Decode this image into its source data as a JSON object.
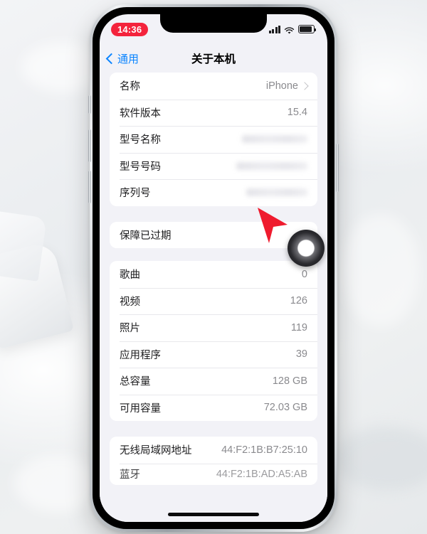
{
  "status_bar": {
    "time": "14:36",
    "recording_pill_color": "#f4233c",
    "icons": [
      "cellular-signal-icon",
      "wifi-icon",
      "battery-icon"
    ]
  },
  "nav": {
    "back_label": "通用",
    "title": "关于本机",
    "accent_color": "#0a84ff"
  },
  "groups": [
    {
      "rows": [
        {
          "label": "名称",
          "value": "iPhone",
          "chevron": true
        },
        {
          "label": "软件版本",
          "value": "15.4",
          "chevron": false
        },
        {
          "label": "型号名称",
          "value": "",
          "redacted": true
        },
        {
          "label": "型号号码",
          "value": "",
          "redacted": true
        },
        {
          "label": "序列号",
          "value": "",
          "redacted": true
        }
      ]
    },
    {
      "rows": [
        {
          "label": "保障已过期",
          "value": "",
          "chevron": false
        }
      ]
    },
    {
      "rows": [
        {
          "label": "歌曲",
          "value": "0"
        },
        {
          "label": "视频",
          "value": "126"
        },
        {
          "label": "照片",
          "value": "119"
        },
        {
          "label": "应用程序",
          "value": "39"
        },
        {
          "label": "总容量",
          "value": "128 GB"
        },
        {
          "label": "可用容量",
          "value": "72.03 GB"
        }
      ]
    },
    {
      "rows": [
        {
          "label": "无线局域网地址",
          "value": "44:F2:1B:B7:25:10"
        },
        {
          "label": "蓝牙",
          "value": "44:F2:1B:AD:A5:AB",
          "clipped": true
        }
      ]
    }
  ],
  "annotation": {
    "cursor": "red-arrow-cursor",
    "tap_ring": "tap-indicator-ring"
  },
  "colors": {
    "background": "#f2f2f7",
    "card": "#ffffff",
    "label": "#1c1c1e",
    "value": "#8a8a8e"
  }
}
